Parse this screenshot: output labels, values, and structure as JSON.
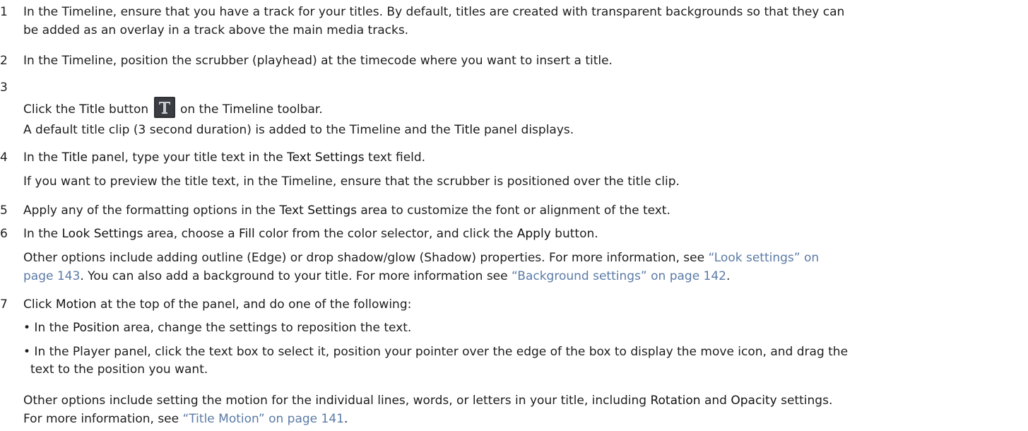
{
  "steps": [
    {
      "num": "1",
      "lines": [
        "In the Timeline, ensure that you have a track for your titles. By default, titles are created with transparent backgrounds so that they can",
        "be added as an overlay in a track above the main media tracks."
      ]
    },
    {
      "num": "2",
      "lines": [
        "In the Timeline, position the scrubber (playhead) at the timecode where you want to insert a title."
      ]
    },
    {
      "num": "3",
      "pre": "Click the ",
      "bold1": "Title",
      "mid": " button",
      "post": " on the Timeline toolbar.",
      "icon": "title-t-icon",
      "note_pre": "A default title clip (3 second duration) is added to the Timeline and the ",
      "note_bold": "Title",
      "note_post": " panel displays."
    },
    {
      "num": "4",
      "pre": "In the ",
      "bold1": "Title",
      "mid": " panel, type your title text in the ",
      "bold2": "Text Settings",
      "post": " text field.",
      "note": "If you want to preview the title text, in the Timeline, ensure that the scrubber is positioned over the title clip."
    },
    {
      "num": "5",
      "pre": "Apply any of the formatting options in the ",
      "bold1": "Text Settings",
      "post": " area to customize the font or alignment of the text."
    },
    {
      "num": "6",
      "pre": "In the ",
      "bold1": "Look Settings",
      "mid": " area, choose a ",
      "bold2": "Fill",
      "mid2": " color from the color selector, and click the ",
      "bold3": "Apply",
      "post": " button.",
      "note_a": "Other options include adding outline (Edge) or drop shadow/glow (Shadow) properties. For more information, see ",
      "link_a": "“Look settings” on",
      "link_a2": "page 143",
      "note_b": ". You can also add a background to your title. For more information see ",
      "link_b": "“Background settings” on page 142",
      "note_c": "."
    },
    {
      "num": "7",
      "pre": "Click ",
      "bold1": "Motion",
      "post": " at the top of the panel, and do one of the following:",
      "bullet1_pre": "• In the ",
      "bullet1_bold": "Position",
      "bullet1_post": " area, change the settings to reposition the text.",
      "bullet2_l1": "• In the Player panel, click the text box to select it, position your pointer over the edge of the box to display the move icon, and drag the",
      "bullet2_l2": "text to the position you want.",
      "note_pre": "Other options include setting the motion for the individual lines, words, or letters in your title, including ",
      "note_bold1": "Rotation",
      "note_mid": " and ",
      "note_bold2": "Opacity",
      "note_post": " settings.",
      "note2_pre": "For more information, see ",
      "note2_link": "“Title Motion” on page 141",
      "note2_post": "."
    }
  ],
  "colors": {
    "text": "#1d1d1d",
    "link": "#5a7aa6",
    "icon_bg": "#2f3134",
    "icon_fg": "#c8ccd0"
  }
}
